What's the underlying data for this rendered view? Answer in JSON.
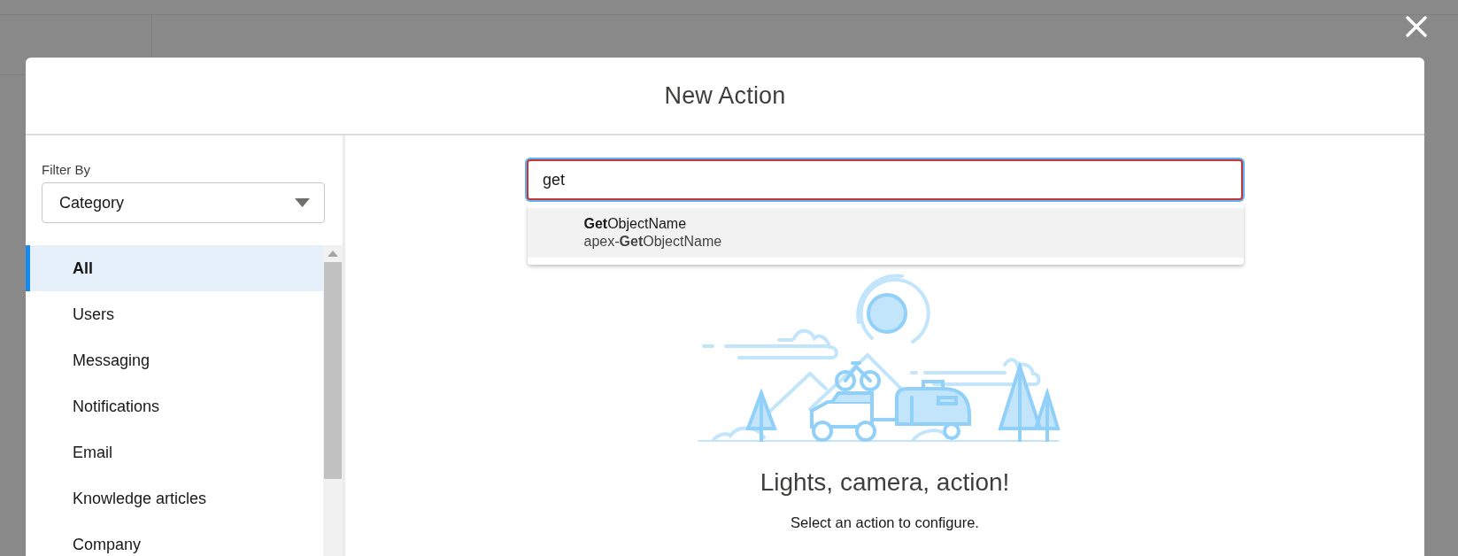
{
  "dialog": {
    "title": "New Action"
  },
  "filter": {
    "label": "Filter By",
    "value": "Category"
  },
  "categories": [
    {
      "label": "All",
      "selected": true
    },
    {
      "label": "Users",
      "selected": false
    },
    {
      "label": "Messaging",
      "selected": false
    },
    {
      "label": "Notifications",
      "selected": false
    },
    {
      "label": "Email",
      "selected": false
    },
    {
      "label": "Knowledge articles",
      "selected": false
    },
    {
      "label": "Company",
      "selected": false
    }
  ],
  "search": {
    "value": "get"
  },
  "suggestions": [
    {
      "title": "**Get**ObjectName",
      "subtitle": "apex-**Get**ObjectName"
    }
  ],
  "empty_state": {
    "heading": "Lights, camera, action!",
    "message": "Select an action to configure."
  }
}
